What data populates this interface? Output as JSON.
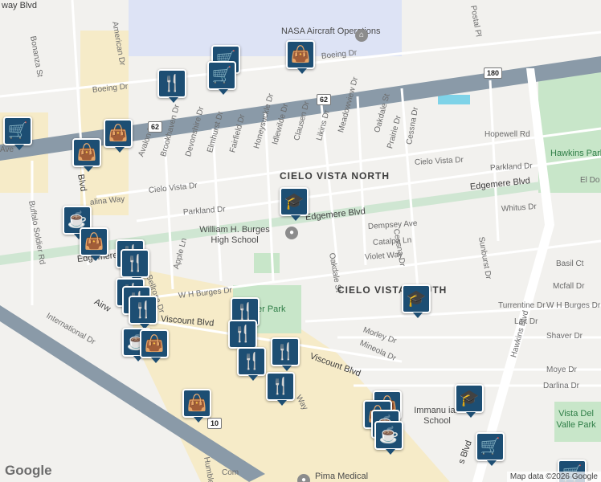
{
  "map": {
    "labels": [
      {
        "id": "boeing-dr-top-left",
        "text": "way Blvd"
      },
      {
        "id": "bonanza-st",
        "text": "Bonanza St"
      },
      {
        "id": "american-dr",
        "text": "American Dr"
      },
      {
        "id": "nasa-label",
        "text": "NASA Aircraft Operations"
      },
      {
        "id": "boeing-dr-right",
        "text": "Boeing Dr"
      },
      {
        "id": "boeing-dr-left",
        "text": "Boeing Dr"
      },
      {
        "id": "postal-pl",
        "text": "Postal Pl"
      },
      {
        "id": "avalon-dr",
        "text": "Avalon Dr"
      },
      {
        "id": "brookhaven-dr",
        "text": "Brookhaven Dr"
      },
      {
        "id": "devonshire-dr",
        "text": "Devonshire Dr"
      },
      {
        "id": "elmhurst-dr",
        "text": "Elmhurst Dr"
      },
      {
        "id": "fairfield-dr",
        "text": "Fairfield Dr"
      },
      {
        "id": "honeysuckle-dr",
        "text": "Honeysuckle Dr"
      },
      {
        "id": "idlewilde-dr",
        "text": "Idlewilde Dr"
      },
      {
        "id": "clausen-dr",
        "text": "Clausen Dr"
      },
      {
        "id": "likins-dr",
        "text": "Likins Dr"
      },
      {
        "id": "meadowview-dr",
        "text": "Meadowview Dr"
      },
      {
        "id": "oakdale-st-top",
        "text": "Oakdale St"
      },
      {
        "id": "prairie-dr",
        "text": "Prairie Dr"
      },
      {
        "id": "cessna-dr-top",
        "text": "Cessna Dr"
      },
      {
        "id": "hopewell-rd",
        "text": "Hopewell Rd"
      },
      {
        "id": "hawkins-park",
        "text": "Hawkins Park"
      },
      {
        "id": "buffalo-soldier-rd",
        "text": "Buffalo Soldier Rd"
      },
      {
        "id": "cielo-vista-dr-right",
        "text": "Cielo Vista Dr"
      },
      {
        "id": "parkland-dr-right",
        "text": "Parkland Dr"
      },
      {
        "id": "el-dorado",
        "text": "El Do"
      },
      {
        "id": "cielo-vista-dr-left",
        "text": "Cielo Vista Dr"
      },
      {
        "id": "cielo-vista-north",
        "text": "CIELO VISTA NORTH"
      },
      {
        "id": "edgemere-blvd-right",
        "text": "Edgemere Blvd"
      },
      {
        "id": "parkland-dr-left",
        "text": "Parkland Dr"
      },
      {
        "id": "whitus-dr",
        "text": "Whitus Dr"
      },
      {
        "id": "burges-hs",
        "text": "William H. Burges High School"
      },
      {
        "id": "edgemere-blvd-mid",
        "text": "Edgemere Blvd"
      },
      {
        "id": "dempsey-ave",
        "text": "Dempsey Ave"
      },
      {
        "id": "catalpa-ln",
        "text": "Catalpa Ln"
      },
      {
        "id": "violet-way",
        "text": "Violet Way"
      },
      {
        "id": "edgemere-left",
        "text": "Edgemere"
      },
      {
        "id": "bellrose-dr",
        "text": "Bellrose Dr"
      },
      {
        "id": "apple-ln",
        "text": "Apple Ln"
      },
      {
        "id": "basil-ct",
        "text": "Basil Ct"
      },
      {
        "id": "sunburst-dr",
        "text": "Sunburst Dr"
      },
      {
        "id": "oakdale-st-mid",
        "text": "Oakdale St"
      },
      {
        "id": "cessna-dr-mid",
        "text": "Cessna Dr"
      },
      {
        "id": "wh-burges-dr-left",
        "text": "W H Burges Dr"
      },
      {
        "id": "cielo-vista-south",
        "text": "CIELO VISTA SOUTH"
      },
      {
        "id": "mcfall-dr",
        "text": "Mcfall Dr"
      },
      {
        "id": "turrentine-dr",
        "text": "Turrentine Dr"
      },
      {
        "id": "wh-burges-dr-right",
        "text": "W H Burges Dr"
      },
      {
        "id": "airway-blvd",
        "text": "Airw"
      },
      {
        "id": "viscount-blvd-left",
        "text": "Viscount Blvd"
      },
      {
        "id": "park-label",
        "text": "er Park"
      },
      {
        "id": "international-dr",
        "text": "International Dr"
      },
      {
        "id": "lait-dr",
        "text": "Lait Dr"
      },
      {
        "id": "shaver-dr",
        "text": "Shaver Dr"
      },
      {
        "id": "morley-dr",
        "text": "Morley Dr"
      },
      {
        "id": "mineola-dr",
        "text": "Mineola Dr"
      },
      {
        "id": "hawkins-blvd",
        "text": "Hawkins Blvd"
      },
      {
        "id": "viscount-blvd-mid",
        "text": "Viscount Blvd"
      },
      {
        "id": "moye-dr",
        "text": "Moye Dr"
      },
      {
        "id": "darlina-dr",
        "text": "Darlina Dr"
      },
      {
        "id": "way-label",
        "text": "Way"
      },
      {
        "id": "vista-del-valle-park",
        "text": "Vista Del Valle Park"
      },
      {
        "id": "immanuel-school",
        "text": "Immanu    ian School"
      },
      {
        "id": "humble-pl",
        "text": "Humble Pl"
      },
      {
        "id": "pima-medical",
        "text": "Pima Medical"
      },
      {
        "id": "blvd-left",
        "text": "Blvd"
      },
      {
        "id": "alina-way",
        "text": "alina Way"
      },
      {
        "id": "s-blvd",
        "text": "s Blvd"
      },
      {
        "id": "cielo-vista-ave",
        "text": "Ave"
      },
      {
        "id": "com-label",
        "text": "Com"
      }
    ],
    "shields": [
      {
        "id": "shield-180",
        "text": "180"
      },
      {
        "id": "shield-62-top",
        "text": "62"
      },
      {
        "id": "shield-62-left",
        "text": "62"
      },
      {
        "id": "shield-10",
        "text": "10"
      }
    ],
    "markers": [
      {
        "id": "m1",
        "icon": "shopping-cart-icon",
        "glyph": "🛒"
      },
      {
        "id": "m2",
        "icon": "shopping-cart-icon",
        "glyph": "🛒"
      },
      {
        "id": "m3",
        "icon": "shopping-bag-icon",
        "glyph": "👜"
      },
      {
        "id": "m4",
        "icon": "restaurant-icon",
        "glyph": "🍴"
      },
      {
        "id": "m5",
        "icon": "shopping-cart-icon",
        "glyph": "🛒"
      },
      {
        "id": "m6",
        "icon": "shopping-bag-icon",
        "glyph": "👜"
      },
      {
        "id": "m7",
        "icon": "shopping-bag-icon",
        "glyph": "👜"
      },
      {
        "id": "m8",
        "icon": "school-icon",
        "glyph": "🎓"
      },
      {
        "id": "m9",
        "icon": "cafe-icon",
        "glyph": "☕"
      },
      {
        "id": "m10",
        "icon": "shopping-bag-icon",
        "glyph": "👜"
      },
      {
        "id": "m11",
        "icon": "restaurant-icon",
        "glyph": "🍴"
      },
      {
        "id": "m12",
        "icon": "restaurant-icon",
        "glyph": "🍴"
      },
      {
        "id": "m13",
        "icon": "restaurant-icon",
        "glyph": "🍴"
      },
      {
        "id": "m14",
        "icon": "restaurant-icon",
        "glyph": "🍴"
      },
      {
        "id": "m15",
        "icon": "restaurant-icon",
        "glyph": "🍴"
      },
      {
        "id": "m16",
        "icon": "restaurant-icon",
        "glyph": "🍴"
      },
      {
        "id": "m17",
        "icon": "cafe-icon",
        "glyph": "☕"
      },
      {
        "id": "m18",
        "icon": "shopping-bag-icon",
        "glyph": "👜"
      },
      {
        "id": "m19",
        "icon": "restaurant-icon",
        "glyph": "🍴"
      },
      {
        "id": "m20",
        "icon": "restaurant-icon",
        "glyph": "🍴"
      },
      {
        "id": "m21",
        "icon": "restaurant-icon",
        "glyph": "🍴"
      },
      {
        "id": "m22",
        "icon": "restaurant-icon",
        "glyph": "🍴"
      },
      {
        "id": "m23",
        "icon": "restaurant-icon",
        "glyph": "🍴"
      },
      {
        "id": "m24",
        "icon": "school-icon",
        "glyph": "🎓"
      },
      {
        "id": "m25",
        "icon": "shopping-bag-icon",
        "glyph": "👜"
      },
      {
        "id": "m26",
        "icon": "shopping-bag-icon",
        "glyph": "👜"
      },
      {
        "id": "m27",
        "icon": "shopping-bag-icon",
        "glyph": "👜"
      },
      {
        "id": "m28",
        "icon": "cafe-icon",
        "glyph": "☕"
      },
      {
        "id": "m29",
        "icon": "cafe-icon",
        "glyph": "☕"
      },
      {
        "id": "m30",
        "icon": "school-icon",
        "glyph": "🎓"
      },
      {
        "id": "m31",
        "icon": "shopping-cart-icon",
        "glyph": "🛒"
      },
      {
        "id": "m32",
        "icon": "shopping-cart-icon",
        "glyph": "🛒"
      }
    ]
  },
  "footer": {
    "logo": "Google",
    "attribution": "Map data ©2026 Google"
  },
  "colors": {
    "pin": "#1d4e73",
    "park": "#c8e6c9",
    "freeway": "#8a9aa8",
    "commercial": "#f6ebc8"
  }
}
